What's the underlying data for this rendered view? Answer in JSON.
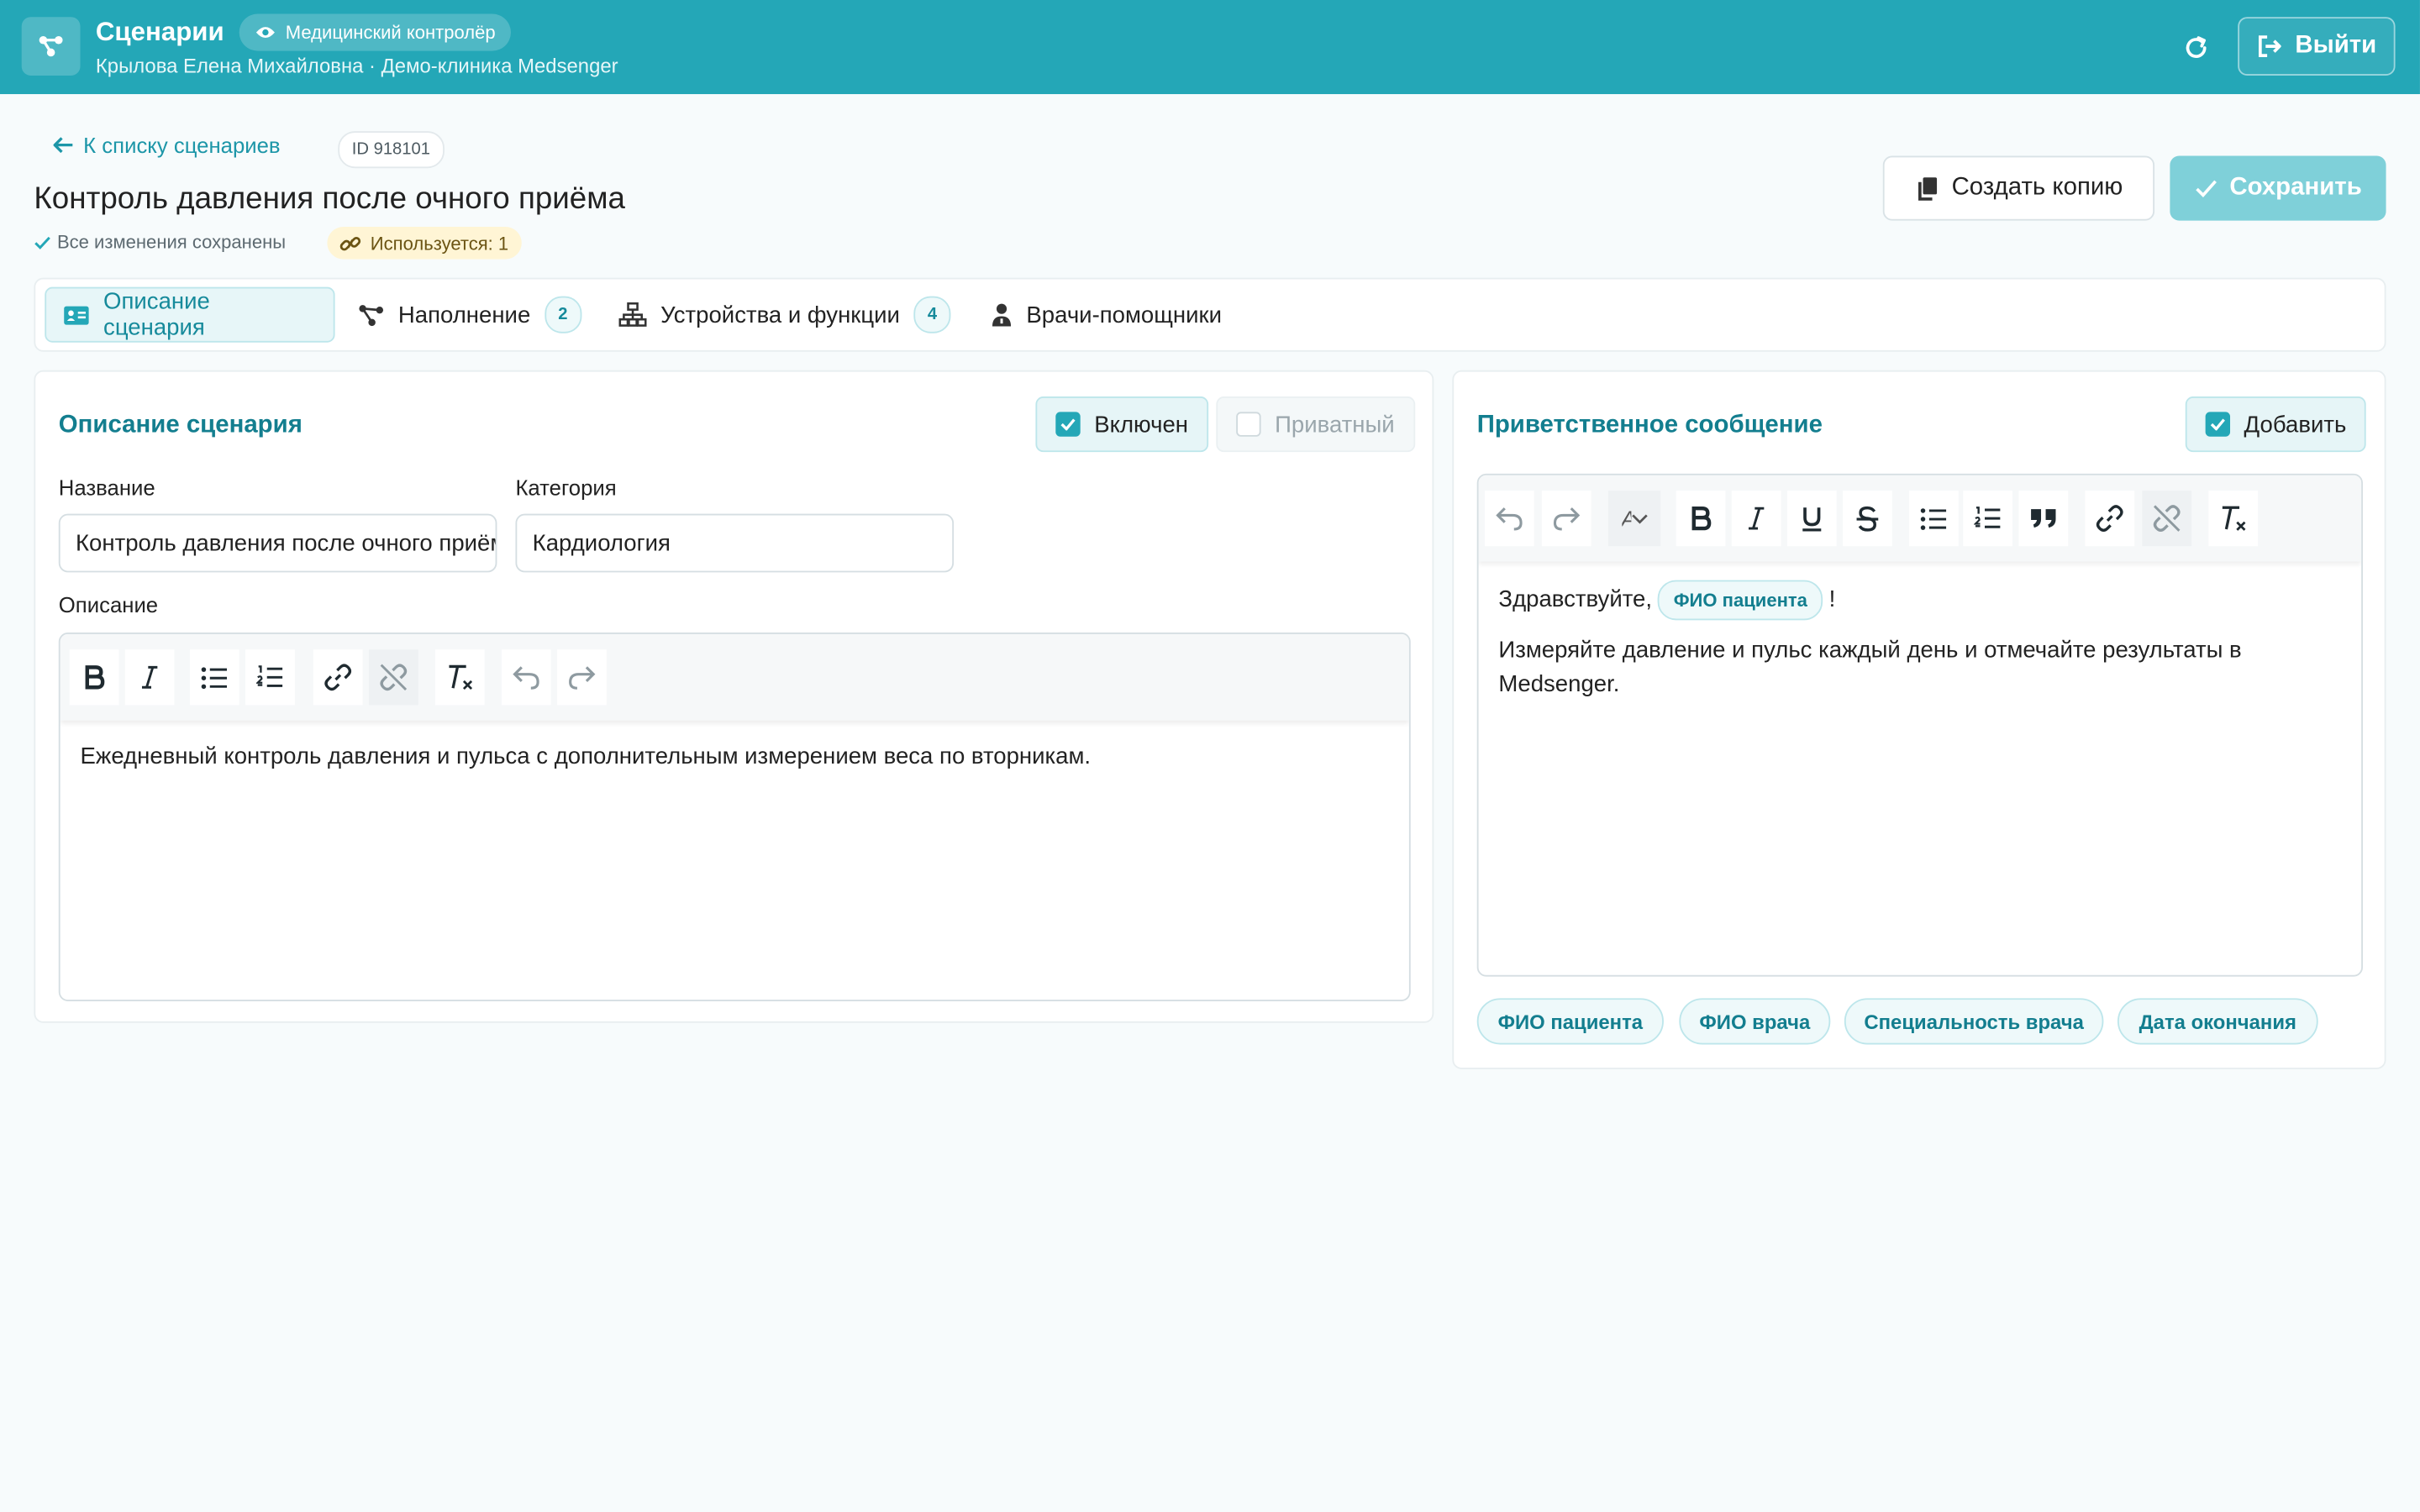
{
  "header": {
    "app_title": "Сценарии",
    "role_badge": "Медицинский контролёр",
    "user_line": "Крылова Елена Михайловна · Демо-клиника Medsenger",
    "logout_label": "Выйти"
  },
  "page": {
    "back_link": "К списку сценариев",
    "id_badge": "ID 918101",
    "title": "Контроль давления после очного приёма",
    "saved_status": "Все изменения сохранены",
    "usage_badge": "Используется: 1",
    "copy_label": "Создать копию",
    "save_label": "Сохранить"
  },
  "tabs": [
    {
      "label": "Описание сценария",
      "count": ""
    },
    {
      "label": "Наполнение",
      "count": "2"
    },
    {
      "label": "Устройства и функции",
      "count": "4"
    },
    {
      "label": "Врачи-помощники",
      "count": ""
    }
  ],
  "description_card": {
    "title": "Описание сценария",
    "enabled_label": "Включен",
    "private_label": "Приватный",
    "name_label": "Название",
    "name_value": "Контроль давления после очного приёма",
    "category_label": "Категория",
    "category_value": "Кардиология",
    "description_label": "Описание",
    "description_text": "Ежедневный контроль давления и пульса с дополнительным измерением веса по вторникам."
  },
  "welcome_card": {
    "title": "Приветственное сообщение",
    "add_label": "Добавить",
    "greeting": "Здравствуйте,",
    "greeting_chip": "ФИО пациента",
    "greeting_end": "!",
    "body_text": "Измеряйте давление и пульс каждый день и отмечайте результаты в Medsenger.",
    "font_glyph": "A",
    "variables": [
      "ФИО пациента",
      "ФИО врача",
      "Специальность врача",
      "Дата окончания"
    ]
  },
  "colors": {
    "brand": "#24a7b7",
    "accent_text": "#137e8f",
    "save_disabled": "#7fd0d9",
    "usage_badge": "#fff5d5"
  }
}
